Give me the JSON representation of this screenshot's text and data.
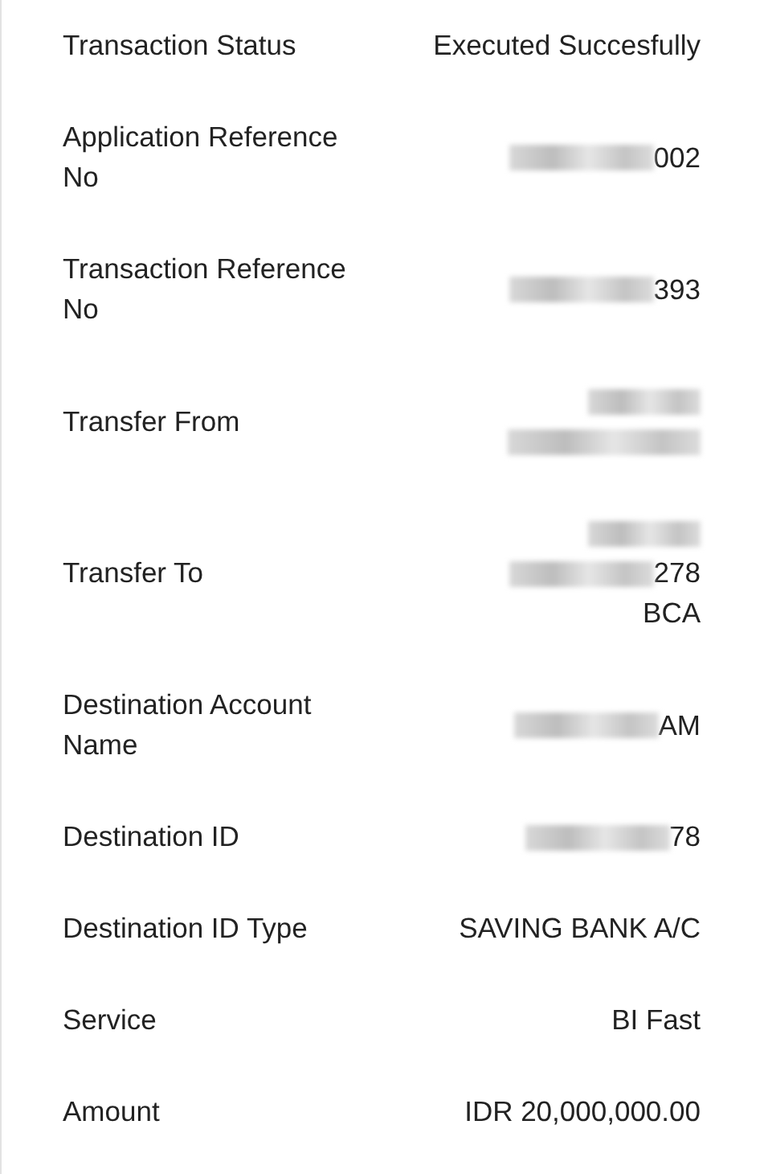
{
  "rows": [
    {
      "label": "Transaction Status",
      "value": [
        {
          "redacted": false,
          "text": "Executed Succesfully"
        }
      ]
    },
    {
      "label": "Application Reference No",
      "value": [
        {
          "redacted": true,
          "text": "002"
        }
      ]
    },
    {
      "label": "Transaction Reference No",
      "value": [
        {
          "redacted": true,
          "text": "393"
        }
      ]
    },
    {
      "label": "Transfer From",
      "value": [
        {
          "redacted": true
        },
        {
          "redacted": true
        }
      ]
    },
    {
      "label": "Transfer To",
      "value": [
        {
          "redacted": true
        },
        {
          "redacted": true,
          "text": "278"
        },
        {
          "redacted": false,
          "text": "BCA"
        }
      ]
    },
    {
      "label": "Destination Account Name",
      "value": [
        {
          "redacted": true,
          "text": "AM"
        }
      ]
    },
    {
      "label": "Destination ID",
      "value": [
        {
          "redacted": true,
          "text": "78"
        }
      ]
    },
    {
      "label": "Destination ID Type",
      "value": [
        {
          "redacted": false,
          "text": "SAVING BANK A/C"
        }
      ]
    },
    {
      "label": "Service",
      "value": [
        {
          "redacted": false,
          "text": "BI Fast"
        }
      ]
    },
    {
      "label": "Amount",
      "value": [
        {
          "redacted": false,
          "text": "IDR 20,000,000.00"
        }
      ]
    }
  ]
}
